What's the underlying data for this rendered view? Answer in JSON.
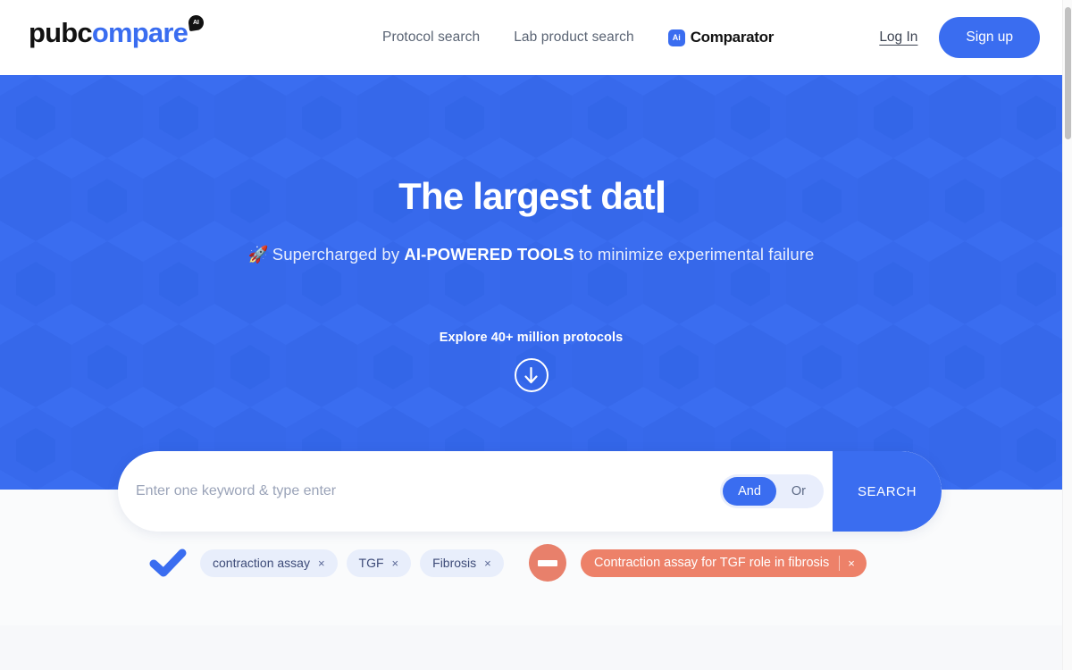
{
  "brand": {
    "logo_pub": "pub",
    "logo_c": "c",
    "logo_ompare": "ompare",
    "logo_badge": "AI",
    "accent_blue": "#3a6df0",
    "coral": "#e8806b",
    "tag_bg": "#e8eefb"
  },
  "header": {
    "nav": [
      {
        "label": "Protocol search",
        "name": "nav-protocol-search"
      },
      {
        "label": "Lab product search",
        "name": "nav-lab-product-search"
      }
    ],
    "comparator": {
      "badge": "Ai",
      "label": "Comparator"
    },
    "login_label": "Log In",
    "signup_label": "Sign up"
  },
  "hero": {
    "title_typed": "The largest dat",
    "subtitle_prefix": "Supercharged by ",
    "subtitle_bold": "AI-POWERED TOOLS",
    "subtitle_suffix": " to minimize experimental failure",
    "rocket_emoji": "🚀",
    "explore_label": "Explore 40+ million protocols",
    "scroll_icon": "arrow-down-circle-icon"
  },
  "search": {
    "placeholder": "Enter one keyword & type enter",
    "value": "",
    "operator_and": "And",
    "operator_or": "Or",
    "operator_selected": "And",
    "button_label": "SEARCH"
  },
  "filters": {
    "include_icon": "check-icon",
    "include_tags": [
      {
        "label": "contraction assay",
        "remove": "×"
      },
      {
        "label": "TGF",
        "remove": "×"
      },
      {
        "label": "Fibrosis",
        "remove": "×"
      }
    ],
    "exclude_icon": "minus-circle-icon",
    "exclude_tags": [
      {
        "label": "Contraction assay for TGF role in fibrosis",
        "remove": "×"
      }
    ]
  },
  "scrollbar": {
    "name": "page-scrollbar"
  }
}
